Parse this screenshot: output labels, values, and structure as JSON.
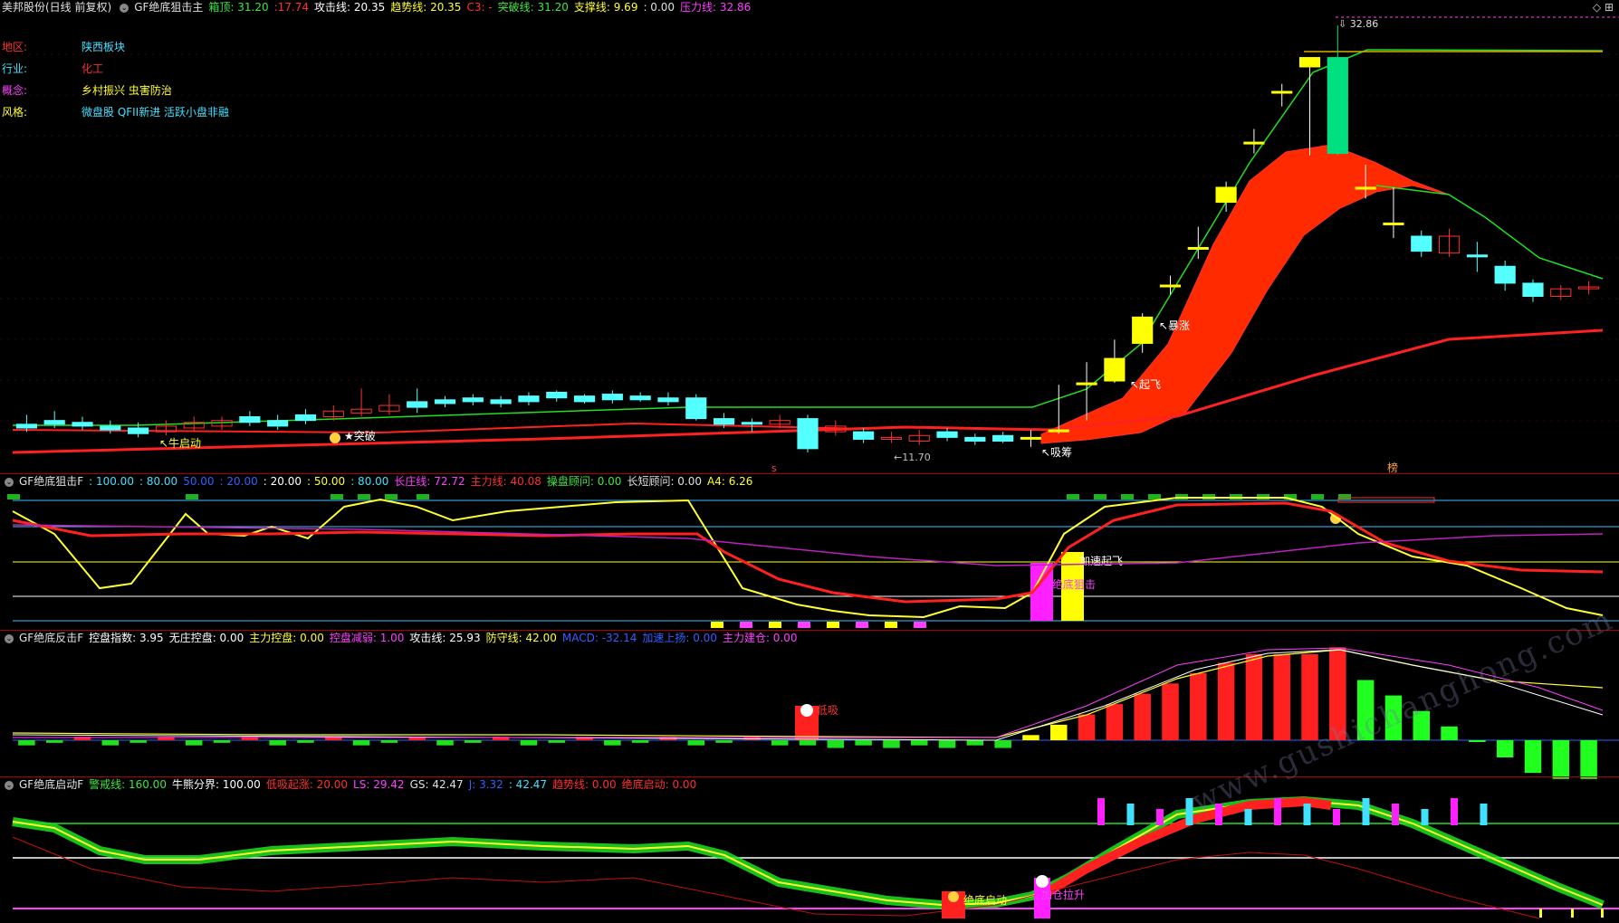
{
  "panel1": {
    "header": [
      {
        "text": "美邦股份(日线 前复权)",
        "color": "#e0e0e0"
      },
      {
        "text": "GF绝底狙击主",
        "color": "#e0e0e0",
        "icon": "chevron-icon"
      },
      {
        "text": "箱顶: 31.20",
        "color": "#3ee63e"
      },
      {
        "text": ":17.74",
        "color": "#ff3030"
      },
      {
        "text": "攻击线: 20.35",
        "color": "#ffffff"
      },
      {
        "text": "趋势线: 20.35",
        "color": "#ffff30"
      },
      {
        "text": "C3: -",
        "color": "#ff3030"
      },
      {
        "text": "突破线: 31.20",
        "color": "#3ee63e"
      },
      {
        "text": "支撑线: 9.69",
        "color": "#ffff30"
      },
      {
        "text": ": 0.00",
        "color": "#e0e0e0"
      },
      {
        "text": "压力线: 32.86",
        "color": "#ff40ff"
      }
    ],
    "info": [
      {
        "label": "地区:",
        "label_color": "#ff3030",
        "value": "陕西板块",
        "value_color": "#40e0ff"
      },
      {
        "label": "行业:",
        "label_color": "#40e0ff",
        "value": "化工",
        "value_color": "#ff3030"
      },
      {
        "label": "概念:",
        "label_color": "#ff40ff",
        "value": "乡村振兴 虫害防治",
        "value_color": "#ffff30"
      },
      {
        "label": "风格:",
        "label_color": "#ffff30",
        "value": "微盘股 QFII新进 活跃小盘非融",
        "value_color": "#40e0ff"
      }
    ],
    "annotations": {
      "high": "32.86",
      "low": "11.70",
      "niu": "牛启动",
      "tupo": "突破",
      "xichou": "吸筹",
      "qifei": "起飞",
      "baozhang": "暴涨",
      "s_mark": "s",
      "bang": "榜"
    }
  },
  "panel2": {
    "header": [
      {
        "text": "GF绝底狙击F",
        "color": "#e0e0e0",
        "icon": "chevron-icon"
      },
      {
        "text": ": 100.00",
        "color": "#40e0ff"
      },
      {
        "text": ": 80.00",
        "color": "#40e0ff"
      },
      {
        "text": "50.00",
        "color": "#3060ff"
      },
      {
        "text": ": 20.00",
        "color": "#3060ff"
      },
      {
        "text": ": 20.00",
        "color": "#ffffff"
      },
      {
        "text": ": 50.00",
        "color": "#ffff30"
      },
      {
        "text": ": 80.00",
        "color": "#40e0ff"
      },
      {
        "text": "长庄线: 72.72",
        "color": "#ff40ff"
      },
      {
        "text": "主力线: 40.08",
        "color": "#ff3030"
      },
      {
        "text": "操盘顾问: 0.00",
        "color": "#3ee63e"
      },
      {
        "text": "长短顾问: 0.00",
        "color": "#e0e0e0"
      },
      {
        "text": "A4: 6.26",
        "color": "#ffff30"
      }
    ],
    "annotations": {
      "jiasu": "加速起飞",
      "juedi": "绝底狙击"
    }
  },
  "panel3": {
    "header": [
      {
        "text": "GF绝底反击F",
        "color": "#e0e0e0",
        "icon": "chevron-icon"
      },
      {
        "text": "控盘指数: 3.95",
        "color": "#ffffff"
      },
      {
        "text": "无庄控盘: 0.00",
        "color": "#ffffff"
      },
      {
        "text": "主力控盘: 0.00",
        "color": "#ffff30"
      },
      {
        "text": "控盘减弱: 1.00",
        "color": "#ff40ff"
      },
      {
        "text": "攻击线: 25.93",
        "color": "#ffffff"
      },
      {
        "text": "防守线: 42.00",
        "color": "#ffff30"
      },
      {
        "text": "MACD: -32.14",
        "color": "#3060ff"
      },
      {
        "text": "加速上扬: 0.00",
        "color": "#3060ff"
      },
      {
        "text": "主力建仓: 0.00",
        "color": "#ff40ff"
      }
    ],
    "annotations": {
      "dixi": "低吸"
    }
  },
  "panel4": {
    "header": [
      {
        "text": "GF绝底启动F",
        "color": "#e0e0e0",
        "icon": "chevron-icon"
      },
      {
        "text": "警戒线: 160.00",
        "color": "#3ee63e"
      },
      {
        "text": "牛熊分界: 100.00",
        "color": "#ffffff"
      },
      {
        "text": "低吸起涨: 20.00",
        "color": "#ff3030"
      },
      {
        "text": "LS: 29.42",
        "color": "#ff40ff"
      },
      {
        "text": "GS: 42.47",
        "color": "#e0e0e0"
      },
      {
        "text": "J: 3.32",
        "color": "#3060ff"
      },
      {
        "text": ": 42.47",
        "color": "#40e0ff"
      },
      {
        "text": "趋势线: 0.00",
        "color": "#ff3030"
      },
      {
        "text": "绝底启动: 0.00",
        "color": "#ff3030"
      }
    ],
    "annotations": {
      "juediqidong": "绝底启动",
      "jiacang": "加仓拉升"
    }
  },
  "watermark": "www.gushichanghong.com",
  "chart_data": {
    "type": "candlestick",
    "candles": [
      [
        11.7,
        11.5,
        12.2,
        11.3,
        "up"
      ],
      [
        11.9,
        11.7,
        12.4,
        11.5,
        "up"
      ],
      [
        11.6,
        11.8,
        12.1,
        11.4,
        "up"
      ],
      [
        11.4,
        11.6,
        11.9,
        11.2,
        "up"
      ],
      [
        11.2,
        11.5,
        11.8,
        11.0,
        "up"
      ],
      [
        11.6,
        11.3,
        11.9,
        11.1,
        "down"
      ],
      [
        11.8,
        11.5,
        12.1,
        11.3,
        "down"
      ],
      [
        11.9,
        11.6,
        12.1,
        11.4,
        "down"
      ],
      [
        12.1,
        11.8,
        12.4,
        11.6,
        "up"
      ],
      [
        11.9,
        11.6,
        12.2,
        11.4,
        "up"
      ],
      [
        12.2,
        11.9,
        12.5,
        11.7,
        "up"
      ],
      [
        12.1,
        12.4,
        12.7,
        11.9,
        "down"
      ],
      [
        12.5,
        12.3,
        13.6,
        12.1,
        "down"
      ],
      [
        12.7,
        12.4,
        13.3,
        12.2,
        "down"
      ],
      [
        12.9,
        12.6,
        13.6,
        12.3,
        "up"
      ],
      [
        13.0,
        12.8,
        13.2,
        12.6,
        "up"
      ],
      [
        13.1,
        12.9,
        13.3,
        12.7,
        "up"
      ],
      [
        13.0,
        12.8,
        13.2,
        12.6,
        "up"
      ],
      [
        13.2,
        12.9,
        13.4,
        12.7,
        "up"
      ],
      [
        13.4,
        13.1,
        13.5,
        12.9,
        "up"
      ],
      [
        13.2,
        12.9,
        13.3,
        12.8,
        "up"
      ],
      [
        13.3,
        13.0,
        13.5,
        12.8,
        "up"
      ],
      [
        13.2,
        13.0,
        13.4,
        12.9,
        "up"
      ],
      [
        13.1,
        12.9,
        13.4,
        12.7,
        "up"
      ],
      [
        13.1,
        12.0,
        13.3,
        11.9,
        "up"
      ],
      [
        12.0,
        11.7,
        12.3,
        11.5,
        "up"
      ],
      [
        11.8,
        11.7,
        12.0,
        11.3,
        "up"
      ],
      [
        11.9,
        11.7,
        12.2,
        11.5,
        "down"
      ],
      [
        12.0,
        10.4,
        12.2,
        10.2,
        "up"
      ],
      [
        11.6,
        11.3,
        11.9,
        11.1,
        "down"
      ],
      [
        11.3,
        10.9,
        11.5,
        10.7,
        "up"
      ],
      [
        11.0,
        10.9,
        11.3,
        10.7,
        "down"
      ],
      [
        11.1,
        10.8,
        11.4,
        10.6,
        "down"
      ],
      [
        11.3,
        11.0,
        11.5,
        10.8,
        "up"
      ],
      [
        11.0,
        10.8,
        11.2,
        10.6,
        "up"
      ],
      [
        11.1,
        10.8,
        11.3,
        10.7,
        "up"
      ],
      [
        11.0,
        11.0,
        11.4,
        10.5,
        "yellow"
      ],
      [
        11.4,
        11.3,
        13.8,
        11.2,
        "yellow"
      ],
      [
        13.9,
        13.8,
        15.0,
        11.9,
        "yellow"
      ],
      [
        14.0,
        15.2,
        16.2,
        13.9,
        "yellow"
      ],
      [
        16.0,
        17.4,
        17.6,
        15.5,
        "yellow"
      ],
      [
        19.1,
        19.1,
        19.6,
        18.6,
        "yellow"
      ],
      [
        21.1,
        21.1,
        22.2,
        20.5,
        "yellow"
      ],
      [
        24.3,
        23.5,
        24.6,
        23.0,
        "yellow"
      ],
      [
        26.7,
        26.7,
        27.4,
        26.1,
        "yellow"
      ],
      [
        29.4,
        29.4,
        29.8,
        28.6,
        "yellow"
      ],
      [
        31.2,
        30.7,
        31.2,
        26.0,
        "yellow"
      ],
      [
        31.2,
        26.1,
        32.9,
        26.0,
        "up"
      ],
      [
        24.3,
        24.3,
        25.5,
        23.7,
        "yellow"
      ],
      [
        22.4,
        22.4,
        24.3,
        21.6,
        "yellow"
      ],
      [
        20.9,
        21.7,
        22.0,
        20.6,
        "up"
      ],
      [
        21.7,
        20.8,
        22.1,
        20.6,
        "down"
      ],
      [
        20.7,
        20.6,
        21.4,
        19.8,
        "up"
      ],
      [
        20.1,
        19.2,
        20.4,
        18.8,
        "up"
      ],
      [
        19.2,
        18.5,
        19.4,
        18.2,
        "up"
      ],
      [
        18.9,
        18.5,
        19.1,
        18.3,
        "down"
      ],
      [
        19.0,
        19.0,
        19.3,
        18.6,
        "down"
      ]
    ]
  }
}
